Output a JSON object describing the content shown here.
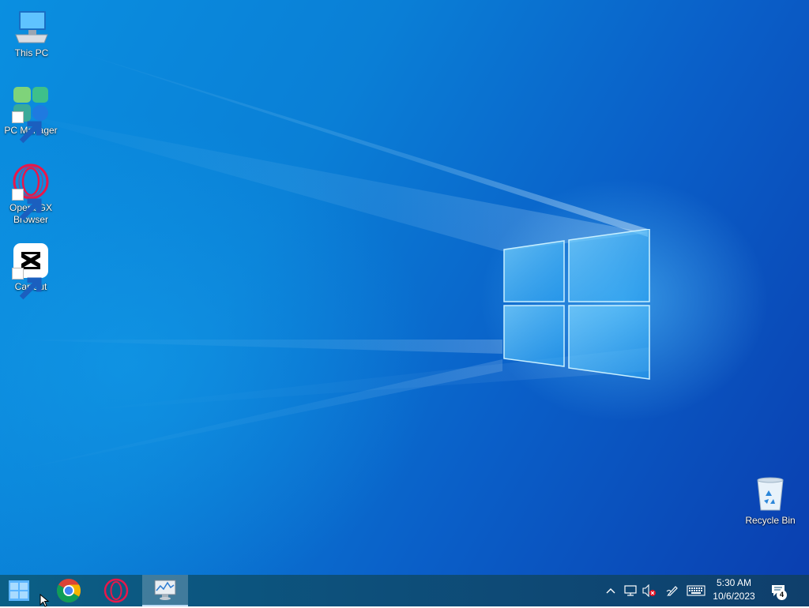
{
  "desktop": {
    "icons": [
      {
        "label": "This PC",
        "icon": "computer-icon"
      },
      {
        "label": "PC Manager",
        "icon": "pc-manager-icon"
      },
      {
        "label_line1": "Opera GX",
        "label_line2": "Browser",
        "icon": "opera-gx-icon"
      },
      {
        "label": "CapCut",
        "icon": "capcut-icon"
      },
      {
        "label": "Recycle Bin",
        "icon": "recycle-bin-icon"
      }
    ]
  },
  "taskbar": {
    "apps": [
      {
        "name": "Start",
        "icon": "windows-start-icon"
      },
      {
        "name": "Google Chrome",
        "icon": "chrome-icon"
      },
      {
        "name": "Opera GX",
        "icon": "opera-icon"
      },
      {
        "name": "Resource Monitor",
        "icon": "resource-monitor-icon"
      }
    ],
    "tray": {
      "time": "5:30 AM",
      "date": "10/6/2023",
      "notification_count": "4",
      "icons": [
        "chevron-up-icon",
        "network-icon",
        "volume-muted-icon",
        "pen-icon",
        "keyboard-icon",
        "notification-icon"
      ]
    }
  },
  "colors": {
    "wallpaper_accent": "#0a7fd6",
    "taskbar": "#0d4f7a"
  }
}
